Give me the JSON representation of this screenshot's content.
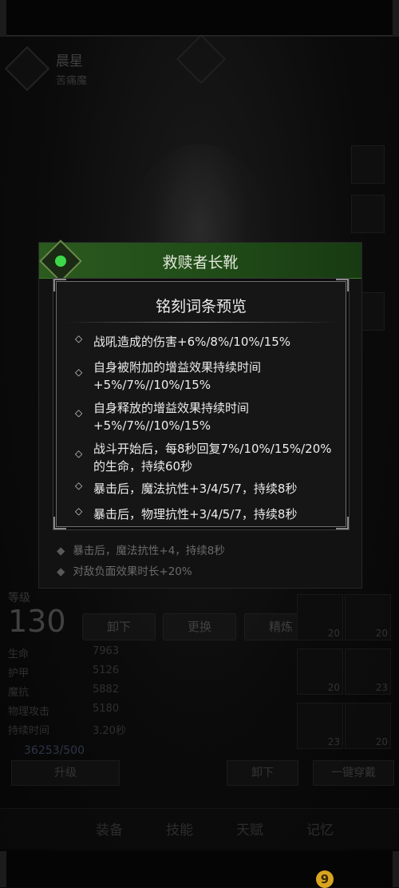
{
  "character": {
    "name": "晨星",
    "class": "苦痛魔"
  },
  "item": {
    "name": "救赎者长靴",
    "gem_color": "#3cd84a",
    "affixes_behind": [
      "暴击后，魔法抗性+4，持续8秒",
      "对敌负面效果时长+20%"
    ]
  },
  "preview": {
    "title": "铭刻词条预览",
    "bullet": "◇",
    "affixes": [
      "战吼造成的伤害+6%/8%/10%/15%",
      "自身被附加的增益效果持续时间+5%/7%//10%/15%",
      "自身释放的增益效果持续时间+5%/7%//10%/15%",
      "战斗开始后，每8秒回复7%/10%/15%/20%的生命，持续60秒",
      "暴击后，魔法抗性+3/4/5/7，持续8秒",
      "暴击后，物理抗性+3/4/5/7，持续8秒"
    ]
  },
  "level": {
    "label": "等级",
    "value": "130"
  },
  "actions": {
    "unequip": "卸下",
    "replace": "更换",
    "refine": "精炼"
  },
  "stats": [
    {
      "name": "生命",
      "value": "7963"
    },
    {
      "name": "护甲",
      "value": "5126"
    },
    {
      "name": "魔抗",
      "value": "5882"
    },
    {
      "name": "物理攻击",
      "value": "5180"
    },
    {
      "name": "持续时间",
      "value": "3.20秒"
    }
  ],
  "currency": "36253/500",
  "buttons": {
    "upgrade": "升级",
    "unequip": "卸下",
    "one_click": "一键穿戴"
  },
  "slot_levels": [
    "20",
    "20",
    "20",
    "23",
    "23",
    "20"
  ],
  "nav": {
    "equip": "装备",
    "skill": "技能",
    "talent": "天赋",
    "journal": "记忆"
  },
  "gold_icon": "9"
}
